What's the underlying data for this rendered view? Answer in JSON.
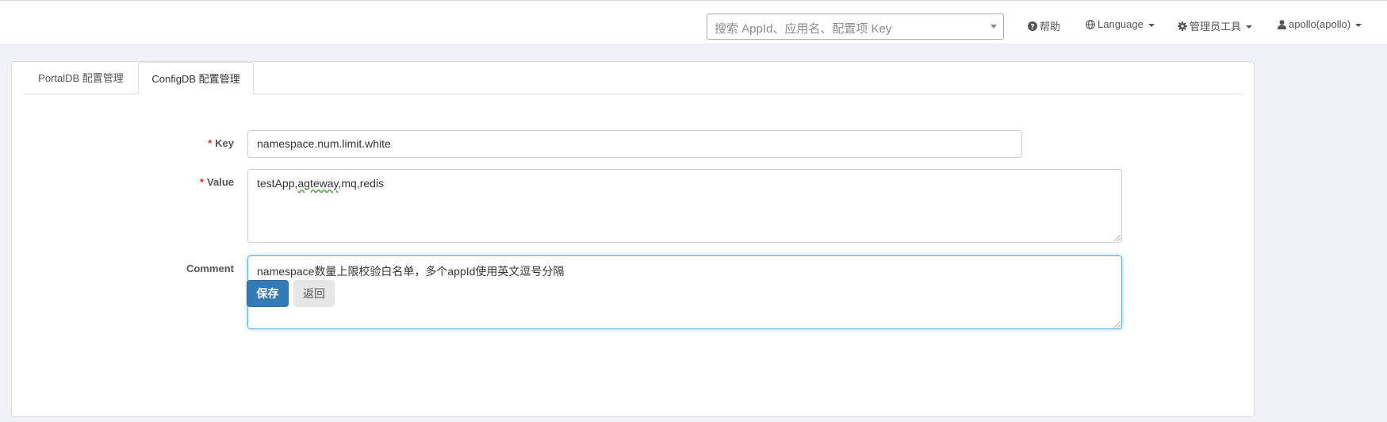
{
  "navbar": {
    "search": {
      "placeholder": "搜索 AppId、应用名、配置项 Key"
    },
    "help_label": "帮助",
    "language_label": "Language",
    "admin_tools_label": "管理员工具",
    "user_label": "apollo(apollo)"
  },
  "tabs": [
    {
      "label": "PortalDB 配置管理",
      "active": false
    },
    {
      "label": "ConfigDB 配置管理",
      "active": true
    }
  ],
  "form": {
    "key_label": "Key",
    "key_value": "namespace.num.limit.white",
    "value_label": "Value",
    "value_value_parts": [
      "testApp,",
      "agteway",
      ",mq,redis"
    ],
    "comment_label": "Comment",
    "comment_value": "namespace数量上限校验白名单，多个appId使用英文逗号分隔",
    "required_marker": "*",
    "save_label": "保存",
    "back_label": "返回"
  },
  "colors": {
    "primary": "#337ab7",
    "required": "#d9302b",
    "focus": "#66afe9",
    "page_bg": "#f1f2f7"
  },
  "icons": {
    "help": "question-circle-icon",
    "language": "globe-icon",
    "admin": "gear-icon",
    "user": "user-icon"
  }
}
